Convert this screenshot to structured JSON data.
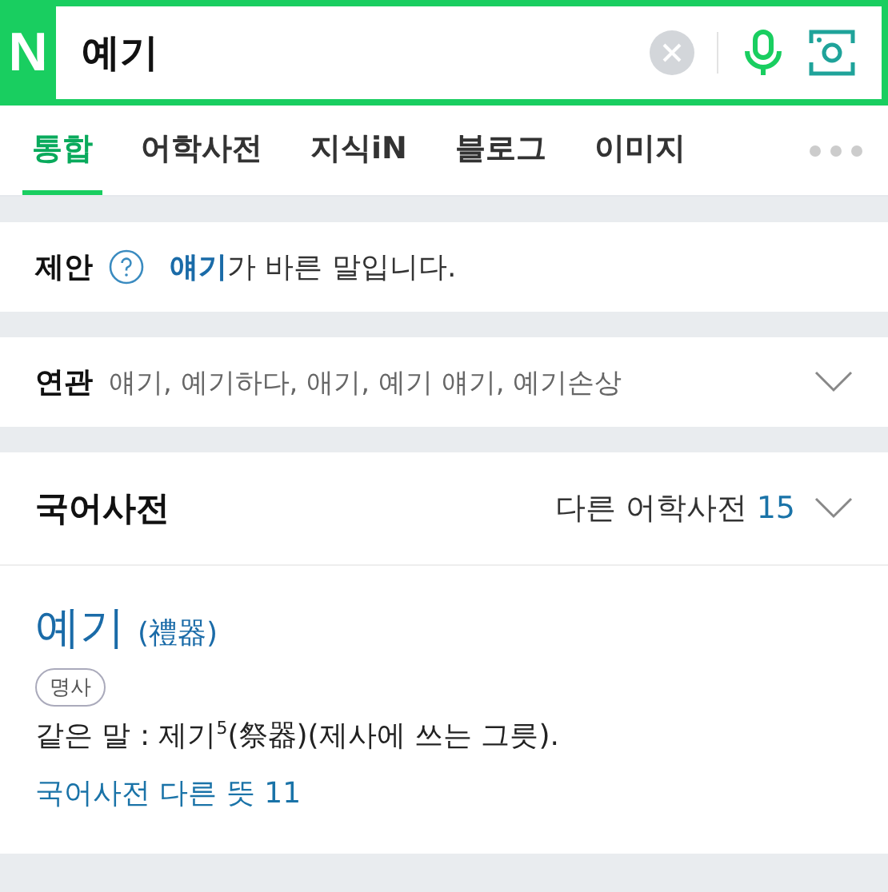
{
  "search": {
    "logo": "N",
    "value": "예기"
  },
  "tabs": [
    {
      "label": "통합",
      "selected": true
    },
    {
      "label": "어학사전",
      "selected": false
    },
    {
      "label": "지식iN",
      "selected": false
    },
    {
      "label": "블로그",
      "selected": false
    },
    {
      "label": "이미지",
      "selected": false
    }
  ],
  "suggestion": {
    "label": "제안",
    "text": "**얘기**가 바른 말입니다."
  },
  "related": {
    "label": "연관",
    "text": "얘기, 예기하다, 애기, 예기 얘기, 예기손상"
  },
  "dictionary": {
    "title": "국어사전",
    "other_label": "다른 어학사전",
    "other_count": "15",
    "entry": {
      "word": "예기",
      "hanja": "(禮器)",
      "part_of_speech": "명사",
      "definition": "같은 말 : 제기$^{5}$(祭器)(제사에 쓰는 그릇).",
      "more_link": "국어사전 다른 뜻 11"
    }
  }
}
